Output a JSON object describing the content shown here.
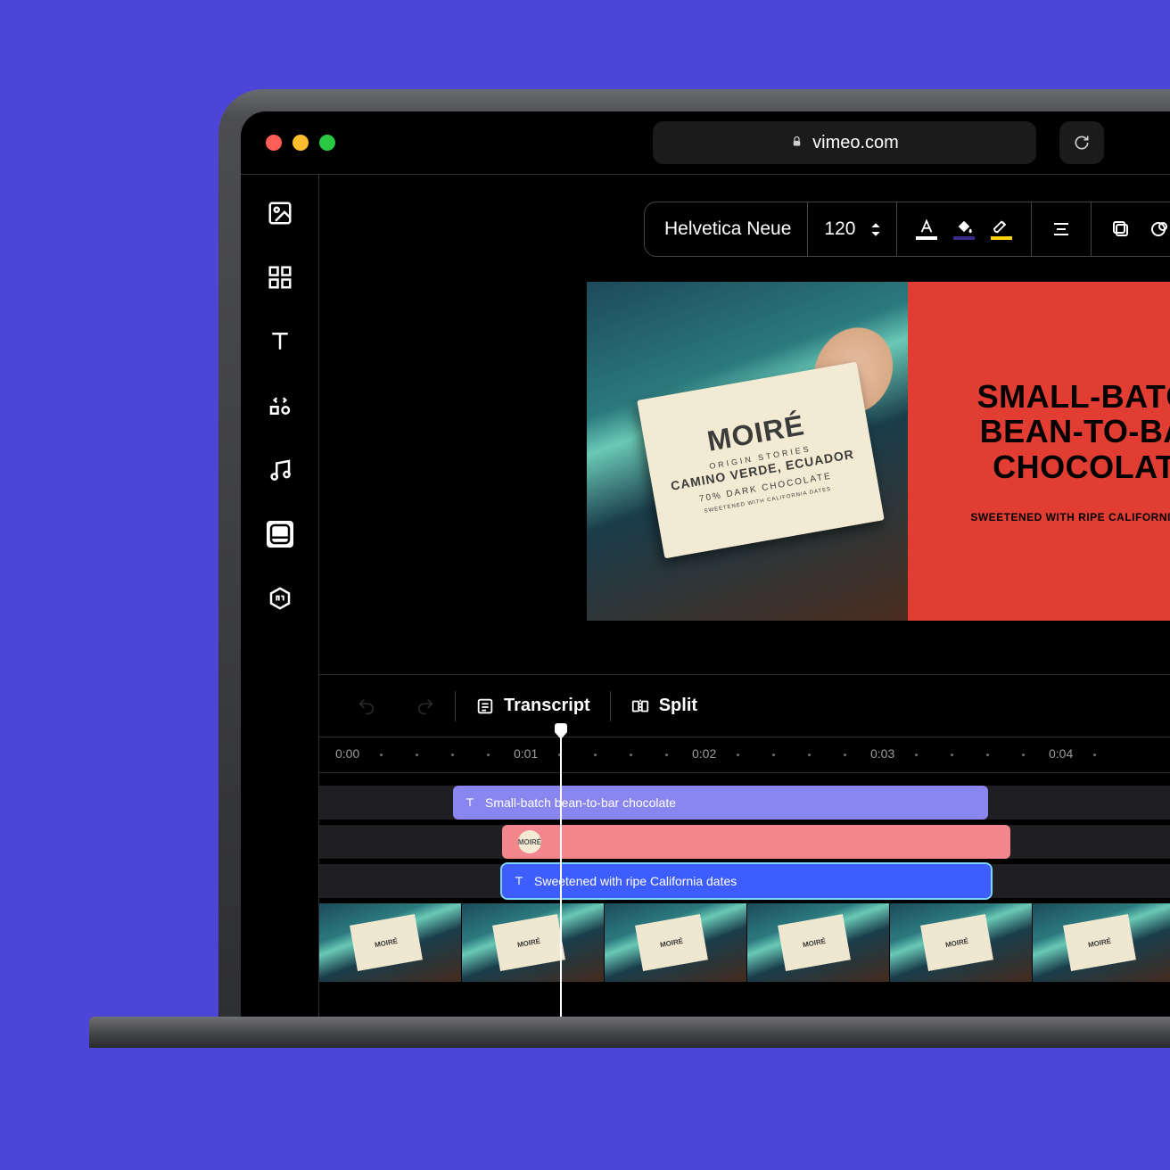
{
  "page_background": "#4d45d7",
  "browser": {
    "traffic_light_colors": [
      "#ff5f57",
      "#febc2e",
      "#28c840"
    ],
    "url": "vimeo.com"
  },
  "sidebar": {
    "items": [
      {
        "name": "image-icon"
      },
      {
        "name": "grid-icon"
      },
      {
        "name": "text-icon"
      },
      {
        "name": "elements-icon"
      },
      {
        "name": "music-icon"
      },
      {
        "name": "style-icon"
      },
      {
        "name": "brand-icon"
      }
    ]
  },
  "text_toolbar": {
    "font": "Helvetica Neue",
    "font_size": "120",
    "text_color_underline": "#ffffff",
    "fill_color_underline": "#3a2b86",
    "highlight_color_underline": "#ffd400"
  },
  "preview": {
    "card": {
      "brand": "MOIRÉ",
      "line1": "ORIGIN STORIES",
      "line2": "CAMINO VERDE, ECUADOR",
      "line3": "70% DARK CHOCOLATE",
      "line4": "SWEETENED WITH CALIFORNIA DATES"
    },
    "text_panel": {
      "headline1": "SMALL-BATCH",
      "headline2": "BEAN-TO-BAR",
      "headline3": "CHOCOLATE",
      "subline": "SWEETENED WITH RIPE CALIFORNIA DATES",
      "bg": "#e23d32"
    }
  },
  "timeline_toolbar": {
    "transcript": "Transcript",
    "split": "Split"
  },
  "ruler": {
    "marks": [
      "0:00",
      "0:01",
      "0:02",
      "0:03",
      "0:04"
    ]
  },
  "tracks": {
    "text1": "Small-batch bean-to-bar chocolate",
    "text2": "Sweetened with ripe California dates",
    "thumb_label": "MOIRÉ"
  },
  "colors": {
    "clip_purple": "#8986ef",
    "clip_pink": "#f3868c",
    "clip_blue": "#3e5dff"
  }
}
